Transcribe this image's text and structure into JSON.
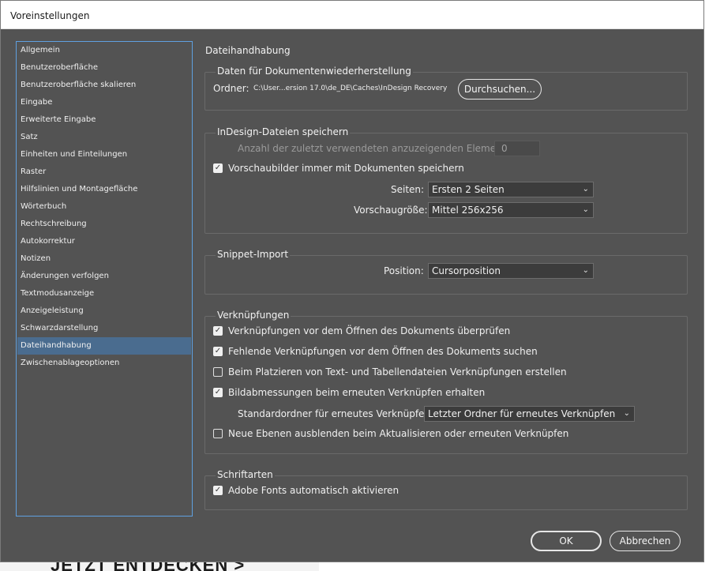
{
  "window": {
    "title": "Voreinstellungen"
  },
  "background": {
    "text": "JETZT ENTDECKEN >"
  },
  "sidebar": {
    "items": [
      {
        "label": "Allgemein",
        "active": false
      },
      {
        "label": "Benutzeroberfläche",
        "active": false
      },
      {
        "label": "Benutzeroberfläche skalieren",
        "active": false
      },
      {
        "label": "Eingabe",
        "active": false
      },
      {
        "label": "Erweiterte Eingabe",
        "active": false
      },
      {
        "label": "Satz",
        "active": false
      },
      {
        "label": "Einheiten und Einteilungen",
        "active": false
      },
      {
        "label": "Raster",
        "active": false
      },
      {
        "label": "Hilfslinien und Montagefläche",
        "active": false
      },
      {
        "label": "Wörterbuch",
        "active": false
      },
      {
        "label": "Rechtschreibung",
        "active": false
      },
      {
        "label": "Autokorrektur",
        "active": false
      },
      {
        "label": "Notizen",
        "active": false
      },
      {
        "label": "Änderungen verfolgen",
        "active": false
      },
      {
        "label": "Textmodusanzeige",
        "active": false
      },
      {
        "label": "Anzeigeleistung",
        "active": false
      },
      {
        "label": "Schwarzdarstellung",
        "active": false
      },
      {
        "label": "Dateihandhabung",
        "active": true
      },
      {
        "label": "Zwischenablageoptionen",
        "active": false
      }
    ]
  },
  "main": {
    "section_title": "Dateihandhabung",
    "recovery": {
      "group_label": "Daten für Dokumentenwiederherstellung",
      "folder_label": "Ordner:",
      "folder_path": "C:\\User...ersion 17.0\\de_DE\\Caches\\InDesign Recovery",
      "browse_button": "Durchsuchen..."
    },
    "save": {
      "group_label": "InDesign-Dateien speichern",
      "recent_label": "Anzahl der zuletzt verwendeten anzuzeigenden Elemente:",
      "recent_value": "0",
      "thumbnails_label": "Vorschaubilder immer mit Dokumenten speichern",
      "thumbnails_checked": true,
      "pages_label": "Seiten:",
      "pages_value": "Ersten 2 Seiten",
      "preview_label": "Vorschaugröße:",
      "preview_value": "Mittel 256x256"
    },
    "snippet": {
      "group_label": "Snippet-Import",
      "position_label": "Position:",
      "position_value": "Cursorposition"
    },
    "links": {
      "group_label": "Verknüpfungen",
      "check_before_open": "Verknüpfungen vor dem Öffnen des Dokuments überprüfen",
      "check_before_open_checked": true,
      "find_missing": "Fehlende Verknüpfungen vor dem Öffnen des Dokuments suchen",
      "find_missing_checked": true,
      "create_links": "Beim Platzieren von Text- und Tabellendateien Verknüpfungen erstellen",
      "create_links_checked": false,
      "preserve_dims": "Bildabmessungen beim erneuten Verknüpfen erhalten",
      "preserve_dims_checked": true,
      "default_folder_label": "Standardordner für erneutes Verknüpfen:",
      "default_folder_value": "Letzter Ordner für erneutes Verknüpfen",
      "hide_layers": "Neue Ebenen ausblenden beim Aktualisieren oder erneuten Verknüpfen",
      "hide_layers_checked": false
    },
    "fonts": {
      "group_label": "Schriftarten",
      "auto_activate": "Adobe Fonts automatisch aktivieren",
      "auto_activate_checked": true
    }
  },
  "footer": {
    "ok_button": "OK",
    "cancel_button": "Abbrechen"
  },
  "icons": {
    "check": "✓",
    "chevron": "⌄"
  }
}
